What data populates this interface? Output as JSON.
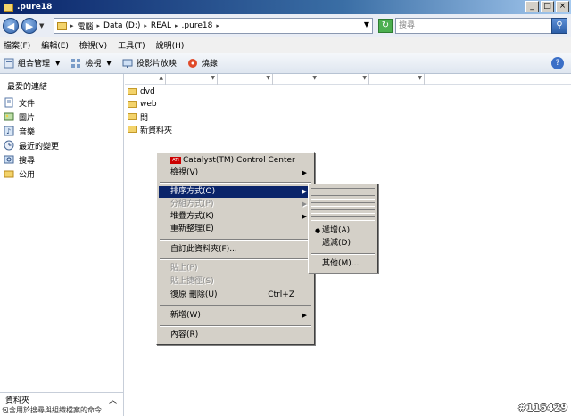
{
  "window": {
    "title": ".pure18",
    "min": "_",
    "max": "□",
    "close": "×"
  },
  "address": {
    "crumbs": [
      "電腦",
      "Data (D:)",
      "REAL",
      ".pure18"
    ],
    "search_placeholder": "搜尋"
  },
  "menubar": [
    "檔案(F)",
    "編輯(E)",
    "檢視(V)",
    "工具(T)",
    "說明(H)"
  ],
  "toolbar": {
    "organize": "組合管理",
    "views": "檢視",
    "slideshow": "投影片放映",
    "burn": "燒錄",
    "help": "?"
  },
  "sidebar": {
    "title": "最愛的連結",
    "items": [
      {
        "label": "文件"
      },
      {
        "label": "圖片"
      },
      {
        "label": "音樂"
      },
      {
        "label": "最近的變更"
      },
      {
        "label": "搜尋"
      },
      {
        "label": "公用"
      }
    ],
    "folders_label": "資料夾",
    "status": "包含用於搜尋與組織檔案的命令..."
  },
  "files": [
    {
      "name": "dvd"
    },
    {
      "name": "web"
    },
    {
      "name": "問"
    },
    {
      "name": "新資料夾"
    }
  ],
  "context_menu": {
    "items": [
      {
        "label": "Catalyst(TM) Control Center",
        "badge": "ATI"
      },
      {
        "label": "檢視(V)"
      },
      {
        "label": "排序方式(O)"
      },
      {
        "label": "分組方式(P)"
      },
      {
        "label": "堆疊方式(K)"
      },
      {
        "label": "重新整理(E)"
      },
      {
        "label": "自訂此資料夾(F)..."
      },
      {
        "label": "貼上(P)"
      },
      {
        "label": "貼上捷徑(S)"
      },
      {
        "label": "復原 刪除(U)",
        "shortcut": "Ctrl+Z"
      },
      {
        "label": "新增(W)"
      },
      {
        "label": "內容(R)"
      }
    ]
  },
  "submenu": {
    "items": [
      {
        "label": "遞增(A)",
        "bullet": "●"
      },
      {
        "label": "遞減(D)"
      },
      {
        "label": "其他(M)..."
      }
    ]
  },
  "watermark": "#115429"
}
